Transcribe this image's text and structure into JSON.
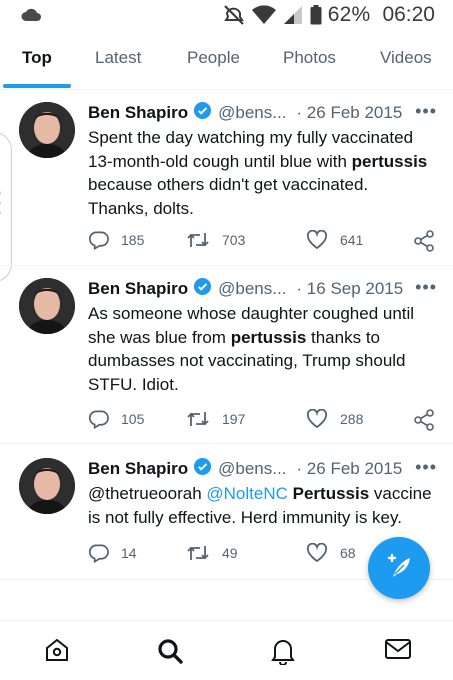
{
  "status_bar": {
    "battery_percent": "62%",
    "time": "06:20",
    "icons": [
      "cloud-icon",
      "mute-icon",
      "wifi-icon",
      "signal-icon",
      "battery-icon"
    ]
  },
  "tabs": [
    {
      "label": "Top",
      "active": true
    },
    {
      "label": "Latest",
      "active": false
    },
    {
      "label": "People",
      "active": false
    },
    {
      "label": "Photos",
      "active": false
    },
    {
      "label": "Videos",
      "active": false
    }
  ],
  "tweets": [
    {
      "name": "Ben Shapiro",
      "handle": "@bens...",
      "date": "· 26 Feb 2015",
      "text": {
        "t1": "Spent the day watching my fully vaccinated 13-month-old cough until blue with ",
        "b1": "pertussis",
        "t2": " because others didn't get vaccinated. Thanks, dolts."
      },
      "replies": "185",
      "retweets": "703",
      "likes": "641"
    },
    {
      "name": "Ben Shapiro",
      "handle": "@bens...",
      "date": "· 16 Sep 2015",
      "text": {
        "t1": "As someone whose daughter coughed until she was blue from ",
        "b1": "pertussis",
        "t2": " thanks to dumbasses not vaccinating, Trump should STFU. Idiot."
      },
      "replies": "105",
      "retweets": "197",
      "likes": "288"
    },
    {
      "name": "Ben Shapiro",
      "handle": "@bens...",
      "date": "· 26 Feb 2015",
      "text": {
        "t1": "@thetrueoorah ",
        "mention": "@NolteNC",
        "t2": " ",
        "b1": "Pertussis",
        "t3": " vaccine is not fully effective. Herd immunity is key."
      },
      "replies": "14",
      "retweets": "49",
      "likes": "68"
    }
  ],
  "more_label": "•••",
  "colors": {
    "accent": "#1d9bf0",
    "text": "#0f1419",
    "muted": "#536471"
  },
  "bottom_nav": [
    "home-icon",
    "search-icon",
    "notifications-icon",
    "messages-icon"
  ]
}
